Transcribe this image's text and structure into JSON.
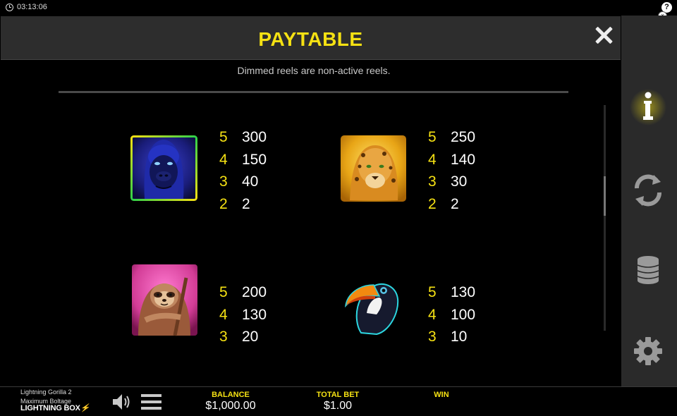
{
  "status_bar": {
    "time": "03:13:06",
    "help_label": "?",
    "close_label": "×"
  },
  "paytable": {
    "title": "PAYTABLE",
    "note": "Dimmed reels are non-active reels.",
    "symbols": [
      {
        "name": "gorilla",
        "pays": [
          {
            "count": "5",
            "value": "300"
          },
          {
            "count": "4",
            "value": "150"
          },
          {
            "count": "3",
            "value": "40"
          },
          {
            "count": "2",
            "value": "2"
          }
        ]
      },
      {
        "name": "leopard",
        "pays": [
          {
            "count": "5",
            "value": "250"
          },
          {
            "count": "4",
            "value": "140"
          },
          {
            "count": "3",
            "value": "30"
          },
          {
            "count": "2",
            "value": "2"
          }
        ]
      },
      {
        "name": "sloth",
        "pays": [
          {
            "count": "5",
            "value": "200"
          },
          {
            "count": "4",
            "value": "130"
          },
          {
            "count": "3",
            "value": "20"
          }
        ]
      },
      {
        "name": "toucan",
        "pays": [
          {
            "count": "5",
            "value": "130"
          },
          {
            "count": "4",
            "value": "100"
          },
          {
            "count": "3",
            "value": "10"
          }
        ]
      }
    ]
  },
  "sidebar": {
    "items": [
      {
        "icon": "info-icon",
        "active": true
      },
      {
        "icon": "autoplay-icon",
        "active": false
      },
      {
        "icon": "coins-icon",
        "active": false
      },
      {
        "icon": "settings-icon",
        "active": false
      }
    ]
  },
  "bottom_bar": {
    "game_name": "Lightning Gorilla 2",
    "studio": "Maximum Boltage",
    "brand": "LIGHTNING BOX",
    "balance_label": "BALANCE",
    "balance_value": "$1,000.00",
    "total_bet_label": "TOTAL BET",
    "total_bet_value": "$1.00",
    "win_label": "WIN",
    "win_value": ""
  },
  "colors": {
    "accent": "#f5e113",
    "panel_header": "#2d2d2d",
    "sidebar": "#2a2a2a",
    "background": "#000000"
  }
}
